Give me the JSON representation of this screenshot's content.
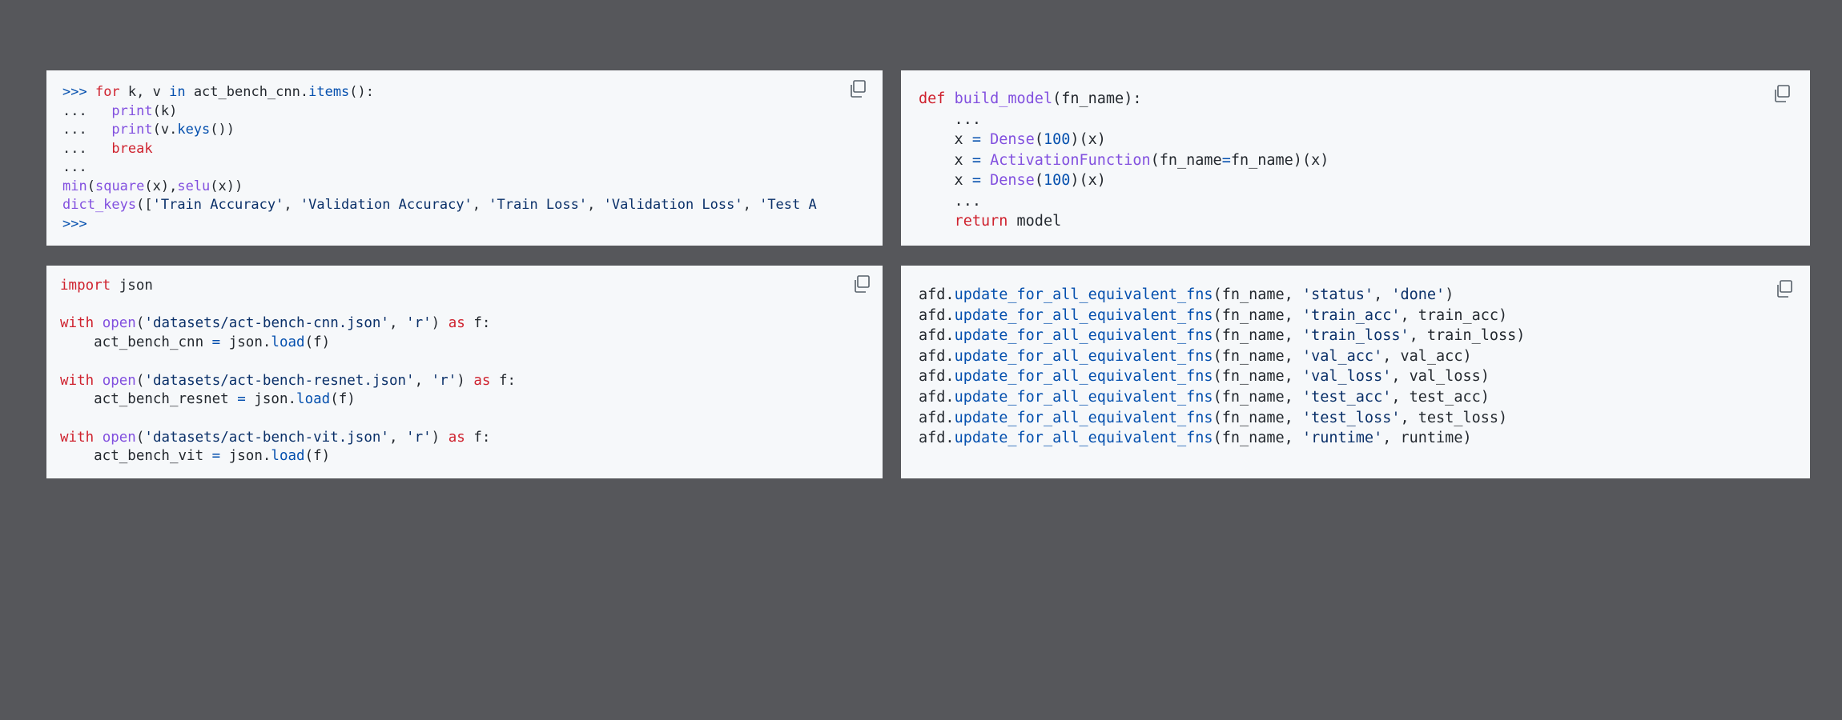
{
  "colors": {
    "background": "#56575b",
    "panel": "#f6f8fa",
    "default": "#24292f",
    "keyword": "#cf222e",
    "function": "#8250df",
    "method": "#0550ae",
    "string": "#0a3069",
    "prompt": "#0550ae",
    "icon": "#57606a"
  },
  "panels": [
    {
      "name": "cnn-loop",
      "copy_icon": "copy-icon",
      "lines": [
        [
          {
            "t": ">>> ",
            "c": "prompt"
          },
          {
            "t": "for",
            "c": "keyword"
          },
          {
            "t": " k, v ",
            "c": "default"
          },
          {
            "t": "in",
            "c": "method"
          },
          {
            "t": " act_bench_cnn.",
            "c": "default"
          },
          {
            "t": "items",
            "c": "method"
          },
          {
            "t": "():",
            "c": "default"
          }
        ],
        [
          {
            "t": "...   ",
            "c": "default"
          },
          {
            "t": "print",
            "c": "function"
          },
          {
            "t": "(k)",
            "c": "default"
          }
        ],
        [
          {
            "t": "...   ",
            "c": "default"
          },
          {
            "t": "print",
            "c": "function"
          },
          {
            "t": "(v.",
            "c": "default"
          },
          {
            "t": "keys",
            "c": "method"
          },
          {
            "t": "())",
            "c": "default"
          }
        ],
        [
          {
            "t": "...   ",
            "c": "default"
          },
          {
            "t": "break",
            "c": "keyword"
          }
        ],
        [
          {
            "t": "...",
            "c": "default"
          }
        ],
        [
          {
            "t": "min",
            "c": "function"
          },
          {
            "t": "(",
            "c": "default"
          },
          {
            "t": "square",
            "c": "function"
          },
          {
            "t": "(x),",
            "c": "default"
          },
          {
            "t": "selu",
            "c": "function"
          },
          {
            "t": "(x))",
            "c": "default"
          }
        ],
        [
          {
            "t": "dict_keys",
            "c": "function"
          },
          {
            "t": "([",
            "c": "default"
          },
          {
            "t": "'Train Accuracy'",
            "c": "string"
          },
          {
            "t": ", ",
            "c": "default"
          },
          {
            "t": "'Validation Accuracy'",
            "c": "string"
          },
          {
            "t": ", ",
            "c": "default"
          },
          {
            "t": "'Train Loss'",
            "c": "string"
          },
          {
            "t": ", ",
            "c": "default"
          },
          {
            "t": "'Validation Loss'",
            "c": "string"
          },
          {
            "t": ", ",
            "c": "default"
          },
          {
            "t": "'Test A",
            "c": "string"
          }
        ],
        [
          {
            "t": ">>>",
            "c": "prompt"
          }
        ]
      ]
    },
    {
      "name": "build-model",
      "copy_icon": "copy-icon",
      "lines": [
        [
          {
            "t": "def",
            "c": "keyword"
          },
          {
            "t": " ",
            "c": "default"
          },
          {
            "t": "build_model",
            "c": "function"
          },
          {
            "t": "(fn_name):",
            "c": "default"
          }
        ],
        [
          {
            "t": "    ...",
            "c": "default"
          }
        ],
        [
          {
            "t": "    x ",
            "c": "default"
          },
          {
            "t": "=",
            "c": "method"
          },
          {
            "t": " ",
            "c": "default"
          },
          {
            "t": "Dense",
            "c": "function"
          },
          {
            "t": "(",
            "c": "default"
          },
          {
            "t": "100",
            "c": "method"
          },
          {
            "t": ")(x)",
            "c": "default"
          }
        ],
        [
          {
            "t": "    x ",
            "c": "default"
          },
          {
            "t": "=",
            "c": "method"
          },
          {
            "t": " ",
            "c": "default"
          },
          {
            "t": "ActivationFunction",
            "c": "function"
          },
          {
            "t": "(fn_name",
            "c": "default"
          },
          {
            "t": "=",
            "c": "method"
          },
          {
            "t": "fn_name)(x)",
            "c": "default"
          }
        ],
        [
          {
            "t": "    x ",
            "c": "default"
          },
          {
            "t": "=",
            "c": "method"
          },
          {
            "t": " ",
            "c": "default"
          },
          {
            "t": "Dense",
            "c": "function"
          },
          {
            "t": "(",
            "c": "default"
          },
          {
            "t": "100",
            "c": "method"
          },
          {
            "t": ")(x)",
            "c": "default"
          }
        ],
        [
          {
            "t": "    ...",
            "c": "default"
          }
        ],
        [
          {
            "t": "    ",
            "c": "default"
          },
          {
            "t": "return",
            "c": "keyword"
          },
          {
            "t": " model",
            "c": "default"
          }
        ]
      ]
    },
    {
      "name": "load-json",
      "copy_icon": "copy-icon",
      "lines": [
        [
          {
            "t": "import",
            "c": "keyword"
          },
          {
            "t": " json",
            "c": "default"
          }
        ],
        [],
        [
          {
            "t": "with",
            "c": "keyword"
          },
          {
            "t": " ",
            "c": "default"
          },
          {
            "t": "open",
            "c": "function"
          },
          {
            "t": "(",
            "c": "default"
          },
          {
            "t": "'datasets/act-bench-cnn.json'",
            "c": "string"
          },
          {
            "t": ", ",
            "c": "default"
          },
          {
            "t": "'r'",
            "c": "string"
          },
          {
            "t": ") ",
            "c": "default"
          },
          {
            "t": "as",
            "c": "keyword"
          },
          {
            "t": " f:",
            "c": "default"
          }
        ],
        [
          {
            "t": "    act_bench_cnn ",
            "c": "default"
          },
          {
            "t": "=",
            "c": "method"
          },
          {
            "t": " json.",
            "c": "default"
          },
          {
            "t": "load",
            "c": "method"
          },
          {
            "t": "(f)",
            "c": "default"
          }
        ],
        [],
        [
          {
            "t": "with",
            "c": "keyword"
          },
          {
            "t": " ",
            "c": "default"
          },
          {
            "t": "open",
            "c": "function"
          },
          {
            "t": "(",
            "c": "default"
          },
          {
            "t": "'datasets/act-bench-resnet.json'",
            "c": "string"
          },
          {
            "t": ", ",
            "c": "default"
          },
          {
            "t": "'r'",
            "c": "string"
          },
          {
            "t": ") ",
            "c": "default"
          },
          {
            "t": "as",
            "c": "keyword"
          },
          {
            "t": " f:",
            "c": "default"
          }
        ],
        [
          {
            "t": "    act_bench_resnet ",
            "c": "default"
          },
          {
            "t": "=",
            "c": "method"
          },
          {
            "t": " json.",
            "c": "default"
          },
          {
            "t": "load",
            "c": "method"
          },
          {
            "t": "(f)",
            "c": "default"
          }
        ],
        [],
        [
          {
            "t": "with",
            "c": "keyword"
          },
          {
            "t": " ",
            "c": "default"
          },
          {
            "t": "open",
            "c": "function"
          },
          {
            "t": "(",
            "c": "default"
          },
          {
            "t": "'datasets/act-bench-vit.json'",
            "c": "string"
          },
          {
            "t": ", ",
            "c": "default"
          },
          {
            "t": "'r'",
            "c": "string"
          },
          {
            "t": ") ",
            "c": "default"
          },
          {
            "t": "as",
            "c": "keyword"
          },
          {
            "t": " f:",
            "c": "default"
          }
        ],
        [
          {
            "t": "    act_bench_vit ",
            "c": "default"
          },
          {
            "t": "=",
            "c": "method"
          },
          {
            "t": " json.",
            "c": "default"
          },
          {
            "t": "load",
            "c": "method"
          },
          {
            "t": "(f)",
            "c": "default"
          }
        ]
      ]
    },
    {
      "name": "update-fns",
      "copy_icon": "copy-icon",
      "lines": [
        [
          {
            "t": "afd.",
            "c": "default"
          },
          {
            "t": "update_for_all_equivalent_fns",
            "c": "method"
          },
          {
            "t": "(fn_name, ",
            "c": "default"
          },
          {
            "t": "'status'",
            "c": "string"
          },
          {
            "t": ", ",
            "c": "default"
          },
          {
            "t": "'done'",
            "c": "string"
          },
          {
            "t": ")",
            "c": "default"
          }
        ],
        [
          {
            "t": "afd.",
            "c": "default"
          },
          {
            "t": "update_for_all_equivalent_fns",
            "c": "method"
          },
          {
            "t": "(fn_name, ",
            "c": "default"
          },
          {
            "t": "'train_acc'",
            "c": "string"
          },
          {
            "t": ", train_acc)",
            "c": "default"
          }
        ],
        [
          {
            "t": "afd.",
            "c": "default"
          },
          {
            "t": "update_for_all_equivalent_fns",
            "c": "method"
          },
          {
            "t": "(fn_name, ",
            "c": "default"
          },
          {
            "t": "'train_loss'",
            "c": "string"
          },
          {
            "t": ", train_loss)",
            "c": "default"
          }
        ],
        [
          {
            "t": "afd.",
            "c": "default"
          },
          {
            "t": "update_for_all_equivalent_fns",
            "c": "method"
          },
          {
            "t": "(fn_name, ",
            "c": "default"
          },
          {
            "t": "'val_acc'",
            "c": "string"
          },
          {
            "t": ", val_acc)",
            "c": "default"
          }
        ],
        [
          {
            "t": "afd.",
            "c": "default"
          },
          {
            "t": "update_for_all_equivalent_fns",
            "c": "method"
          },
          {
            "t": "(fn_name, ",
            "c": "default"
          },
          {
            "t": "'val_loss'",
            "c": "string"
          },
          {
            "t": ", val_loss)",
            "c": "default"
          }
        ],
        [
          {
            "t": "afd.",
            "c": "default"
          },
          {
            "t": "update_for_all_equivalent_fns",
            "c": "method"
          },
          {
            "t": "(fn_name, ",
            "c": "default"
          },
          {
            "t": "'test_acc'",
            "c": "string"
          },
          {
            "t": ", test_acc)",
            "c": "default"
          }
        ],
        [
          {
            "t": "afd.",
            "c": "default"
          },
          {
            "t": "update_for_all_equivalent_fns",
            "c": "method"
          },
          {
            "t": "(fn_name, ",
            "c": "default"
          },
          {
            "t": "'test_loss'",
            "c": "string"
          },
          {
            "t": ", test_loss)",
            "c": "default"
          }
        ],
        [
          {
            "t": "afd.",
            "c": "default"
          },
          {
            "t": "update_for_all_equivalent_fns",
            "c": "method"
          },
          {
            "t": "(fn_name, ",
            "c": "default"
          },
          {
            "t": "'runtime'",
            "c": "string"
          },
          {
            "t": ", runtime)",
            "c": "default"
          }
        ]
      ]
    }
  ]
}
